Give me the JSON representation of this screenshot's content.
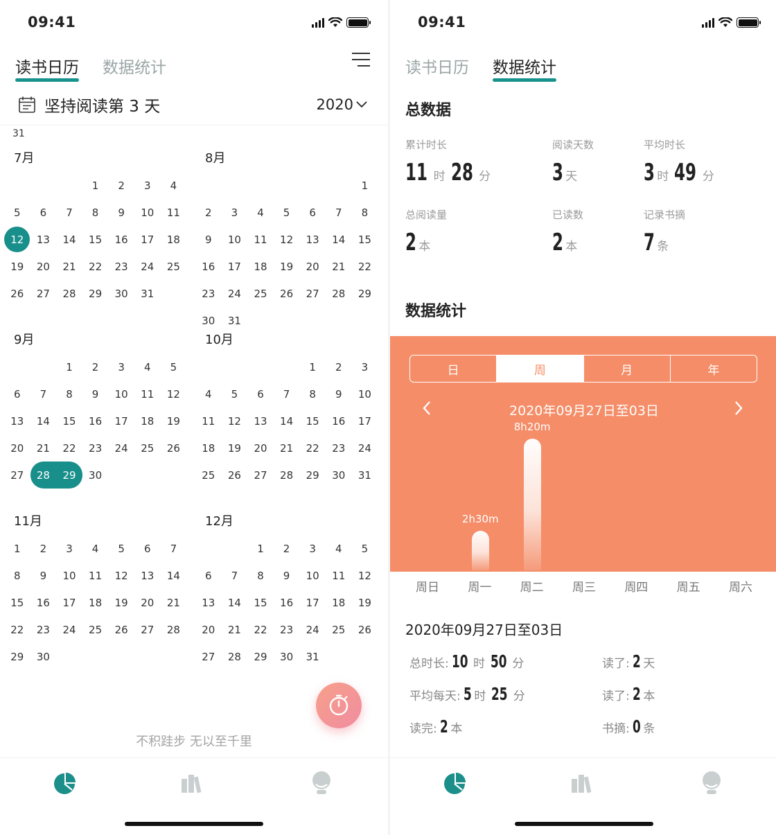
{
  "left": {
    "status": {
      "time": "09:41"
    },
    "tabs": [
      "读书日历",
      "数据统计"
    ],
    "streak_text": "坚持阅读第 3 天",
    "year": "2020",
    "prev_month_tail": "31",
    "months": [
      {
        "title": "7月",
        "offset": 3,
        "days": 31,
        "selected": [
          12
        ]
      },
      {
        "title": "8月",
        "offset": 6,
        "days": 31,
        "selected": []
      },
      {
        "title": "9月",
        "offset": 2,
        "days": 30,
        "selected": [
          28,
          29
        ]
      },
      {
        "title": "10月",
        "offset": 4,
        "days": 31,
        "selected": []
      },
      {
        "title": "11月",
        "offset": 0,
        "days": 30,
        "selected": []
      },
      {
        "title": "12月",
        "offset": 2,
        "days": 31,
        "selected": []
      }
    ],
    "motto": "不积跬步 无以至千里"
  },
  "right": {
    "status": {
      "time": "09:41"
    },
    "tabs": [
      "读书日历",
      "数据统计"
    ],
    "total_title": "总数据",
    "stats": {
      "total_duration": {
        "label": "累计时长",
        "h": "11",
        "h_unit": "时",
        "m": "28",
        "m_unit": "分"
      },
      "read_days": {
        "label": "阅读天数",
        "value": "3",
        "unit": "天"
      },
      "avg_duration": {
        "label": "平均时长",
        "h": "3",
        "h_unit": "时",
        "m": "49",
        "m_unit": "分"
      },
      "total_read": {
        "label": "总阅读量",
        "value": "2",
        "unit": "本"
      },
      "finished": {
        "label": "已读数",
        "value": "2",
        "unit": "本"
      },
      "notes": {
        "label": "记录书摘",
        "value": "7",
        "unit": "条"
      }
    },
    "stats_title": "数据统计",
    "period_tabs": [
      "日",
      "周",
      "月",
      "年"
    ],
    "active_period": "周",
    "range_text": "2020年09月27日至03日",
    "colors": {
      "accent": "#188f8a",
      "chart_bg": "#f48d68"
    },
    "summary": {
      "title": "2020年09月27日至03日",
      "total_label": "总时长:",
      "total_h": "10",
      "total_h_unit": "时",
      "total_m": "50",
      "total_m_unit": "分",
      "avg_label": "平均每天:",
      "avg_h": "5",
      "avg_h_unit": "时",
      "avg_m": "25",
      "avg_m_unit": "分",
      "finished_label": "读完:",
      "finished_value": "2",
      "finished_unit": "本",
      "days_label": "读了:",
      "days_value": "2",
      "days_unit": "天",
      "books_label": "读了:",
      "books_value": "2",
      "books_unit": "本",
      "notes_label": "书摘:",
      "notes_value": "0",
      "notes_unit": "条"
    }
  },
  "chart_data": {
    "type": "bar",
    "categories": [
      "周日",
      "周一",
      "周二",
      "周三",
      "周四",
      "周五",
      "周六"
    ],
    "values_minutes": [
      0,
      150,
      500,
      0,
      0,
      0,
      0
    ],
    "data_labels": [
      "",
      "2h30m",
      "8h20m",
      "",
      "",
      "",
      ""
    ],
    "ylim": [
      0,
      500
    ]
  }
}
